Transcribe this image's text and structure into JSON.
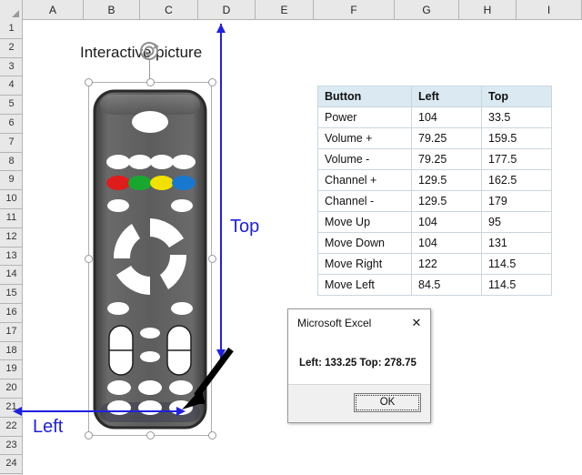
{
  "app": {
    "name": "Microsoft Excel",
    "column_headers": [
      "A",
      "B",
      "C",
      "D",
      "E",
      "F",
      "G",
      "H",
      "I"
    ],
    "row_headers": [
      "1",
      "2",
      "3",
      "4",
      "5",
      "6",
      "7",
      "8",
      "9",
      "10",
      "11",
      "12",
      "13",
      "14",
      "15",
      "16",
      "17",
      "18",
      "19",
      "20",
      "21",
      "22",
      "23",
      "24"
    ]
  },
  "picture": {
    "title": "Interactive picture",
    "selected": true
  },
  "annotations": {
    "top_label": "Top",
    "left_label": "Left",
    "arrow_color": "#2020e0",
    "pointer_color": "#000000"
  },
  "table": {
    "headers": [
      "Button",
      "Left",
      "Top"
    ],
    "header_bg": "#dbeaf2",
    "rows": [
      [
        "Power",
        "104",
        "33.5"
      ],
      [
        "Volume +",
        "79.25",
        "159.5"
      ],
      [
        "Volume -",
        "79.25",
        "177.5"
      ],
      [
        "Channel +",
        "129.5",
        "162.5"
      ],
      [
        "Channel -",
        "129.5",
        "179"
      ],
      [
        "Move Up",
        "104",
        "95"
      ],
      [
        "Move Down",
        "104",
        "131"
      ],
      [
        "Move Right",
        "122",
        "114.5"
      ],
      [
        "Move Left",
        "84.5",
        "114.5"
      ]
    ]
  },
  "dialog": {
    "title": "Microsoft Excel",
    "close_label": "✕",
    "message": "Left: 133.25 Top: 278.75",
    "ok_label": "OK"
  },
  "remote": {
    "body_color": "#5a5a5a",
    "button_color": "#ffffff",
    "color_keys": [
      "#e01b1b",
      "#18a830",
      "#f2e000",
      "#1878d0"
    ]
  }
}
